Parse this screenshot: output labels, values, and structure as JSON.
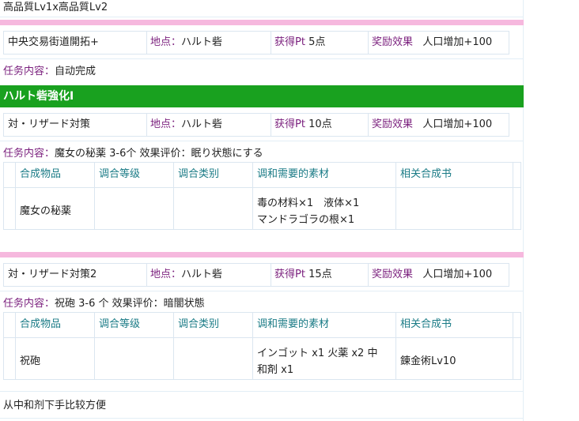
{
  "top_text": "高品質Lv1x高品質Lv2",
  "quests": [
    {
      "name": "中央交易街道開拓+",
      "location_label": "地点：",
      "location": "ハルト砦",
      "pt_label": "获得Pt",
      "pt": "5点",
      "reward_label": "奖励效果",
      "reward": "人口增加+100",
      "task_label": "任务内容：",
      "task": "自动完成"
    },
    {
      "name": "対・リザード対策",
      "location_label": "地点：",
      "location": "ハルト砦",
      "pt_label": "获得Pt",
      "pt": "10点",
      "reward_label": "奖励效果",
      "reward": "人口增加+100",
      "task_label": "任务内容：",
      "task": "魔女の秘薬 3-6个 效果评价：眠り状態にする"
    },
    {
      "name": "対・リザード対策2",
      "location_label": "地点：",
      "location": "ハルト砦",
      "pt_label": "获得Pt",
      "pt": "15点",
      "reward_label": "奖励效果",
      "reward": "人口增加+100",
      "task_label": "任务内容：",
      "task": "祝砲 3-6 个  效果评价：暗闇状態"
    }
  ],
  "section_title": "ハルト砦強化I",
  "table_headers": [
    "合成物品",
    "调合等级",
    "调合类别",
    "调和需要的素材",
    "相关合成书"
  ],
  "recipes": [
    {
      "item": "魔女の秘薬",
      "level": "",
      "category": "",
      "materials_line1": "毒の材料×1　液体×1",
      "materials_line2": "マンドラゴラの根×1",
      "book": ""
    },
    {
      "item": "祝砲",
      "level": "",
      "category": "",
      "materials_line1": "インゴット x1 火薬 x2 中",
      "materials_line2": "和剤 x1",
      "book": "錬金術Lv10"
    }
  ],
  "note": "从中和剂下手比较方便",
  "colors": {
    "pink_bar": "#f6b8de",
    "green_bar": "#19a11f",
    "label_purple": "#7a1f7d",
    "header_teal": "#1a7b86"
  }
}
